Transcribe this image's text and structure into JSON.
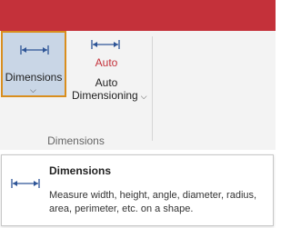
{
  "ribbon": {
    "dimensions_button": {
      "label": "Dimensions",
      "icon": "dimension-arrow-icon",
      "dropdown_icon": "chevron-down-icon"
    },
    "auto_button": {
      "badge": "Auto",
      "label_line1": "Auto",
      "label_line2": "Dimensioning",
      "icon": "dimension-arrow-icon",
      "dropdown_icon": "chevron-down-icon"
    },
    "group_label": "Dimensions"
  },
  "tooltip": {
    "title": "Dimensions",
    "description": "Measure width, height, angle, diameter, radius, area, perimeter, etc. on a shape.",
    "icon": "dimension-arrow-icon"
  },
  "colors": {
    "title_bar": "#c4313a",
    "selected_button_bg": "#c9d6e6",
    "selected_button_border": "#d98e1e",
    "icon_blue": "#2e5597",
    "auto_red": "#c4313a"
  }
}
